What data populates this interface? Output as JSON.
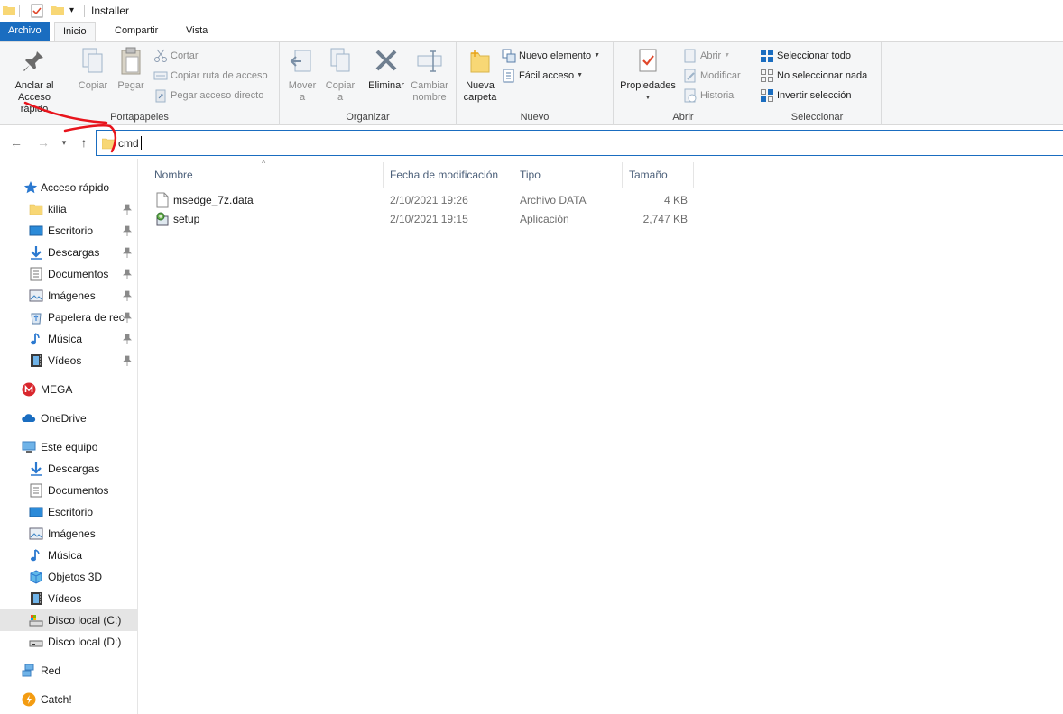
{
  "window": {
    "title": "Installer"
  },
  "tabs": [
    {
      "label": "Archivo"
    },
    {
      "label": "Inicio"
    },
    {
      "label": "Compartir"
    },
    {
      "label": "Vista"
    }
  ],
  "ribbon": {
    "portapapeles": {
      "label": "Portapapeles",
      "anclar_line1": "Anclar al",
      "anclar_line2": "Acceso rápido",
      "copiar": "Copiar",
      "pegar": "Pegar",
      "cortar": "Cortar",
      "copiar_ruta": "Copiar ruta de acceso",
      "pegar_acceso": "Pegar acceso directo"
    },
    "organizar": {
      "label": "Organizar",
      "mover_line1": "Mover",
      "mover_line2": "a",
      "copiar_line1": "Copiar",
      "copiar_line2": "a",
      "eliminar": "Eliminar",
      "cambiar_line1": "Cambiar",
      "cambiar_line2": "nombre"
    },
    "nuevo": {
      "label": "Nuevo",
      "nueva_line1": "Nueva",
      "nueva_line2": "carpeta",
      "nuevo_elemento": "Nuevo elemento",
      "facil_acceso": "Fácil acceso"
    },
    "abrir": {
      "label": "Abrir",
      "propiedades": "Propiedades",
      "abrir": "Abrir",
      "modificar": "Modificar",
      "historial": "Historial"
    },
    "seleccionar": {
      "label": "Seleccionar",
      "todo": "Seleccionar todo",
      "ninguno": "No seleccionar nada",
      "invertir": "Invertir selección"
    }
  },
  "address": {
    "value": "cmd"
  },
  "navpane": {
    "quick_access": "Acceso rápido",
    "quick_items": [
      {
        "label": "kilia",
        "icon": "folder-icon"
      },
      {
        "label": "Escritorio",
        "icon": "desktop-icon"
      },
      {
        "label": "Descargas",
        "icon": "download-icon"
      },
      {
        "label": "Documentos",
        "icon": "documents-icon"
      },
      {
        "label": "Imágenes",
        "icon": "pictures-icon"
      },
      {
        "label": "Papelera de rec",
        "icon": "recycle-bin-icon"
      },
      {
        "label": "Música",
        "icon": "music-icon"
      },
      {
        "label": "Vídeos",
        "icon": "videos-icon"
      }
    ],
    "mega": "MEGA",
    "onedrive": "OneDrive",
    "this_pc": "Este equipo",
    "pc_items": [
      {
        "label": "Descargas",
        "icon": "download-icon"
      },
      {
        "label": "Documentos",
        "icon": "documents-icon"
      },
      {
        "label": "Escritorio",
        "icon": "desktop-icon"
      },
      {
        "label": "Imágenes",
        "icon": "pictures-icon"
      },
      {
        "label": "Música",
        "icon": "music-icon"
      },
      {
        "label": "Objetos 3D",
        "icon": "3d-objects-icon"
      },
      {
        "label": "Vídeos",
        "icon": "videos-icon"
      },
      {
        "label": "Disco local (C:)",
        "icon": "drive-c-icon"
      },
      {
        "label": "Disco local (D:)",
        "icon": "drive-d-icon"
      }
    ],
    "network": "Red",
    "catch": "Catch!"
  },
  "columns": {
    "name": "Nombre",
    "modified": "Fecha de modificación",
    "type": "Tipo",
    "size": "Tamaño"
  },
  "files": [
    {
      "name": "msedge_7z.data",
      "modified": "2/10/2021 19:26",
      "type": "Archivo DATA",
      "size": "4 KB",
      "icon": "file-icon"
    },
    {
      "name": "setup",
      "modified": "2/10/2021 19:15",
      "type": "Aplicación",
      "size": "2,747 KB",
      "icon": "setup-app-icon"
    }
  ],
  "colors": {
    "accent": "#1a6dc0",
    "annotation": "#e8141c",
    "folder": "#f8d775"
  }
}
